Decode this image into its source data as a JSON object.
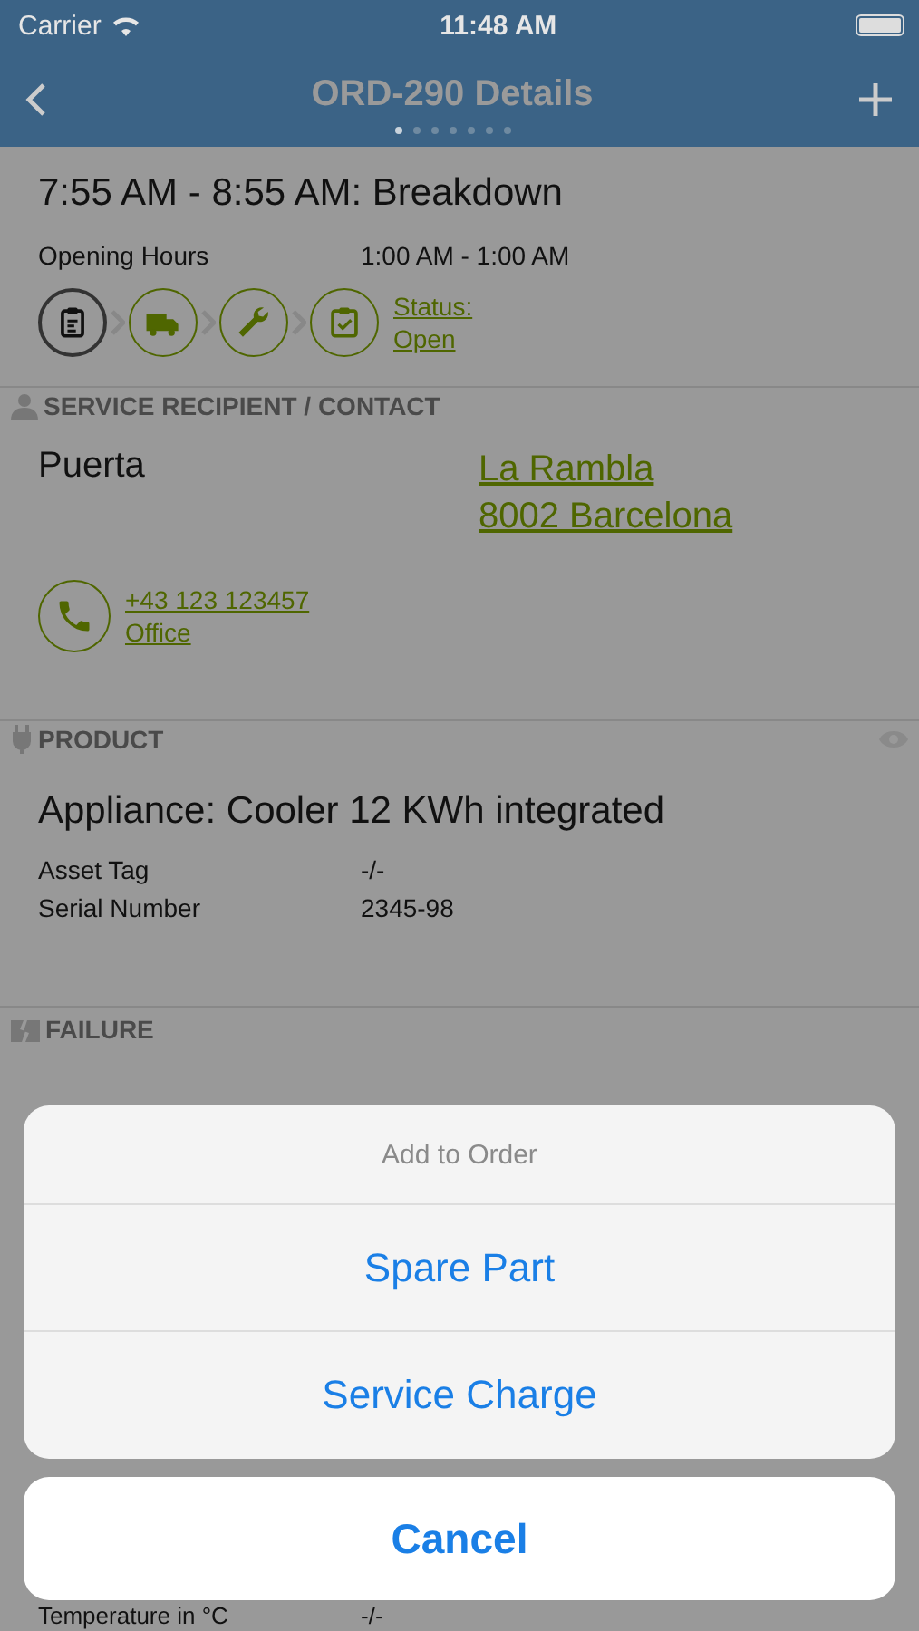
{
  "status_bar": {
    "carrier": "Carrier",
    "time": "11:48 AM"
  },
  "nav_bar": {
    "title": "ORD-290 Details",
    "page_dots": [
      {
        "selected": true
      },
      {
        "selected": false
      },
      {
        "selected": false
      },
      {
        "selected": false
      },
      {
        "selected": false
      },
      {
        "selected": false
      },
      {
        "selected": false
      }
    ]
  },
  "appointment": {
    "title": "7:55 AM - 8:55 AM: Breakdown",
    "label": "Opening Hours",
    "value": "1:00 AM - 1:00 AM",
    "workflow": [
      {
        "kind": "clipboard",
        "selected": true
      },
      {
        "kind": "truck",
        "selected": false
      },
      {
        "kind": "wrench",
        "selected": false
      },
      {
        "kind": "check",
        "selected": false
      }
    ],
    "status_link": [
      "Status:",
      "Open"
    ]
  },
  "contact": {
    "header": "SERVICE RECIPIENT / CONTACT",
    "name": "Puerta",
    "address": [
      "La Rambla",
      "8002 Barcelona"
    ],
    "phone": "+43 123 123457",
    "phone_type": "Office"
  },
  "product": {
    "header": "PRODUCT",
    "title": "Appliance: Cooler 12 KWh integrated",
    "fields": [
      {
        "label": "Asset Tag",
        "value": "-/-"
      },
      {
        "label": "Serial Number",
        "value": "2345-98"
      }
    ]
  },
  "failure": {
    "header": "FAILURE"
  },
  "measurement": {
    "label": "Temperature in °C",
    "value": "-/-"
  },
  "action_sheet": {
    "title": "Add to Order",
    "actions": [
      "Spare Part",
      "Service Charge"
    ],
    "cancel": "Cancel"
  }
}
